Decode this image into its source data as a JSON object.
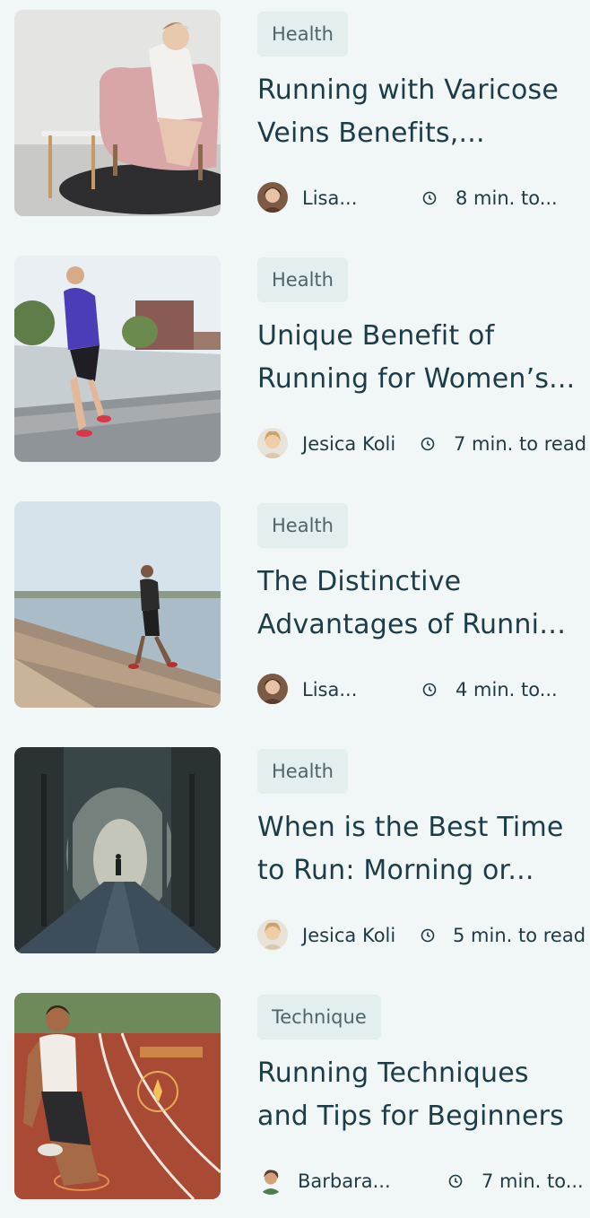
{
  "articles": [
    {
      "category": "Health",
      "title_line1": "Running with Varicose",
      "title_line2": "Veins Benefits,...",
      "author": "Lisa...",
      "read_time": "8 min. to...",
      "image": "woman-in-pink-armchair-holding-leg",
      "avatar": "lisa-avatar"
    },
    {
      "category": "Health",
      "title_line1": "Unique Benefit of",
      "title_line2": "Running for Women’s...",
      "author": "Jesica Koli",
      "read_time": "7 min. to read",
      "image": "woman-running-on-road",
      "avatar": "jesica-avatar"
    },
    {
      "category": "Health",
      "title_line1": "The Distinctive",
      "title_line2": "Advantages of Runnin...",
      "author": "Lisa...",
      "read_time": "4 min. to...",
      "image": "man-running-on-pier-by-lake",
      "avatar": "lisa-avatar"
    },
    {
      "category": "Health",
      "title_line1": "When is the Best Time",
      "title_line2": "to Run: Morning or...",
      "author": "Jesica Koli",
      "read_time": "5 min. to read",
      "image": "runner-in-misty-forest-road",
      "avatar": "jesica-avatar"
    },
    {
      "category": "Technique",
      "title_line1": "Running Techniques",
      "title_line2": "and Tips for Beginners",
      "author": "Barbara...",
      "read_time": "7 min. to...",
      "image": "woman-on-running-track-with-hud",
      "avatar": "barbara-avatar"
    }
  ],
  "icons": {
    "clock": "clock-icon"
  },
  "colors": {
    "background": "#f1f6f6",
    "badge": "#e3eeee",
    "title": "#1c3d47"
  }
}
